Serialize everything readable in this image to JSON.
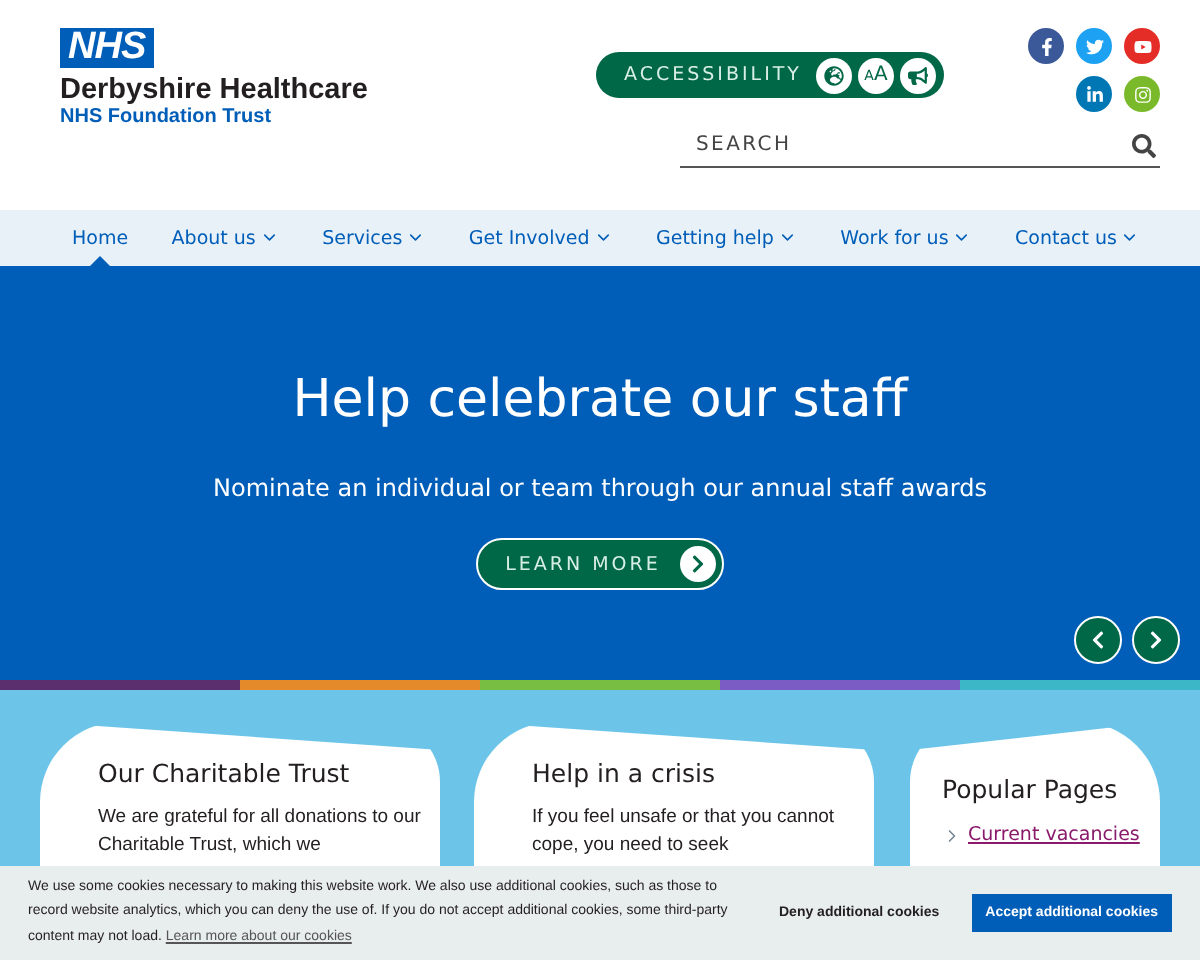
{
  "header": {
    "logo": "NHS",
    "org_name": "Derbyshire Healthcare",
    "org_sub": "NHS Foundation Trust",
    "accessibility": {
      "label": "ACCESSIBILITY",
      "size_glyph_small": "A",
      "size_glyph_large": "A"
    },
    "search": {
      "placeholder": "SEARCH"
    }
  },
  "nav": [
    {
      "label": "Home",
      "selected": true,
      "dropdown": false
    },
    {
      "label": "About us",
      "selected": false,
      "dropdown": true
    },
    {
      "label": "Services",
      "selected": false,
      "dropdown": true
    },
    {
      "label": "Get Involved",
      "selected": false,
      "dropdown": true
    },
    {
      "label": "Getting help",
      "selected": false,
      "dropdown": true
    },
    {
      "label": "Work for us",
      "selected": false,
      "dropdown": true
    },
    {
      "label": "Contact us",
      "selected": false,
      "dropdown": true
    }
  ],
  "hero": {
    "title": "Help celebrate our staff",
    "subtitle": "Nominate an individual or team through our annual staff awards",
    "button": "LEARN MORE"
  },
  "stripe": [
    {
      "color": "#5b2e6e"
    },
    {
      "color": "#e48a2a"
    },
    {
      "color": "#78be43"
    },
    {
      "color": "#7b5cc4"
    },
    {
      "color": "#3cb7c8"
    }
  ],
  "cards": [
    {
      "title": "Our Charitable Trust",
      "text": "We are grateful for all donations to our Charitable Trust, which we"
    },
    {
      "title": "Help in a crisis",
      "text": "If you feel unsafe or that you cannot cope, you need to seek"
    }
  ],
  "popular": {
    "title": "Popular Pages",
    "links": [
      "Current vacancies"
    ]
  },
  "cookie_bar": {
    "text": "We use some cookies necessary to making this website work. We also use additional cookies, such as those to record website analytics, which you can deny the use of. If you do not accept additional cookies, some third-party content may not load.",
    "link": "Learn more about our cookies",
    "deny": "Deny additional cookies",
    "accept": "Accept additional cookies"
  }
}
